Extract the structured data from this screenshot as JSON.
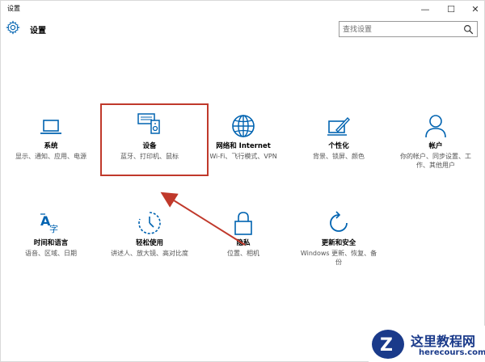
{
  "window": {
    "title": "设置",
    "minimize_glyph": "—",
    "maximize_glyph": "☐",
    "close_glyph": "✕"
  },
  "header": {
    "app_title": "设置",
    "search_placeholder": "查找设置",
    "icons": [
      "gear-icon",
      "search-icon"
    ]
  },
  "tiles": [
    {
      "label": "系统",
      "desc": "显示、通知、应用、电源",
      "icon": "laptop-icon"
    },
    {
      "label": "设备",
      "desc": "蓝牙、打印机、鼠标",
      "icon": "devices-icon"
    },
    {
      "label": "网络和 Internet",
      "desc": "Wi-Fi、飞行模式、VPN",
      "icon": "globe-icon"
    },
    {
      "label": "个性化",
      "desc": "背景、锁屏、颜色",
      "icon": "personalization-icon"
    },
    {
      "label": "帐户",
      "desc": "你的帐户、同步设置、工作、其他用户",
      "icon": "person-icon"
    },
    {
      "label": "时间和语言",
      "desc": "语音、区域、日期",
      "icon": "time-language-icon"
    },
    {
      "label": "轻松使用",
      "desc": "讲述人、放大镜、高对比度",
      "icon": "ease-of-access-icon"
    },
    {
      "label": "隐私",
      "desc": "位置、相机",
      "icon": "lock-icon"
    },
    {
      "label": "更新和安全",
      "desc": "Windows 更新、恢复、备份",
      "icon": "update-icon"
    }
  ],
  "annotation": {
    "highlight_color": "#c0392b",
    "arrow_color": "#c0392b"
  },
  "watermark": {
    "title": "这里教程网",
    "url": "herecours.com",
    "logo_letter": "Z"
  },
  "colors": {
    "accent": "#0063b1",
    "text": "#000000",
    "subtext": "#555555"
  }
}
